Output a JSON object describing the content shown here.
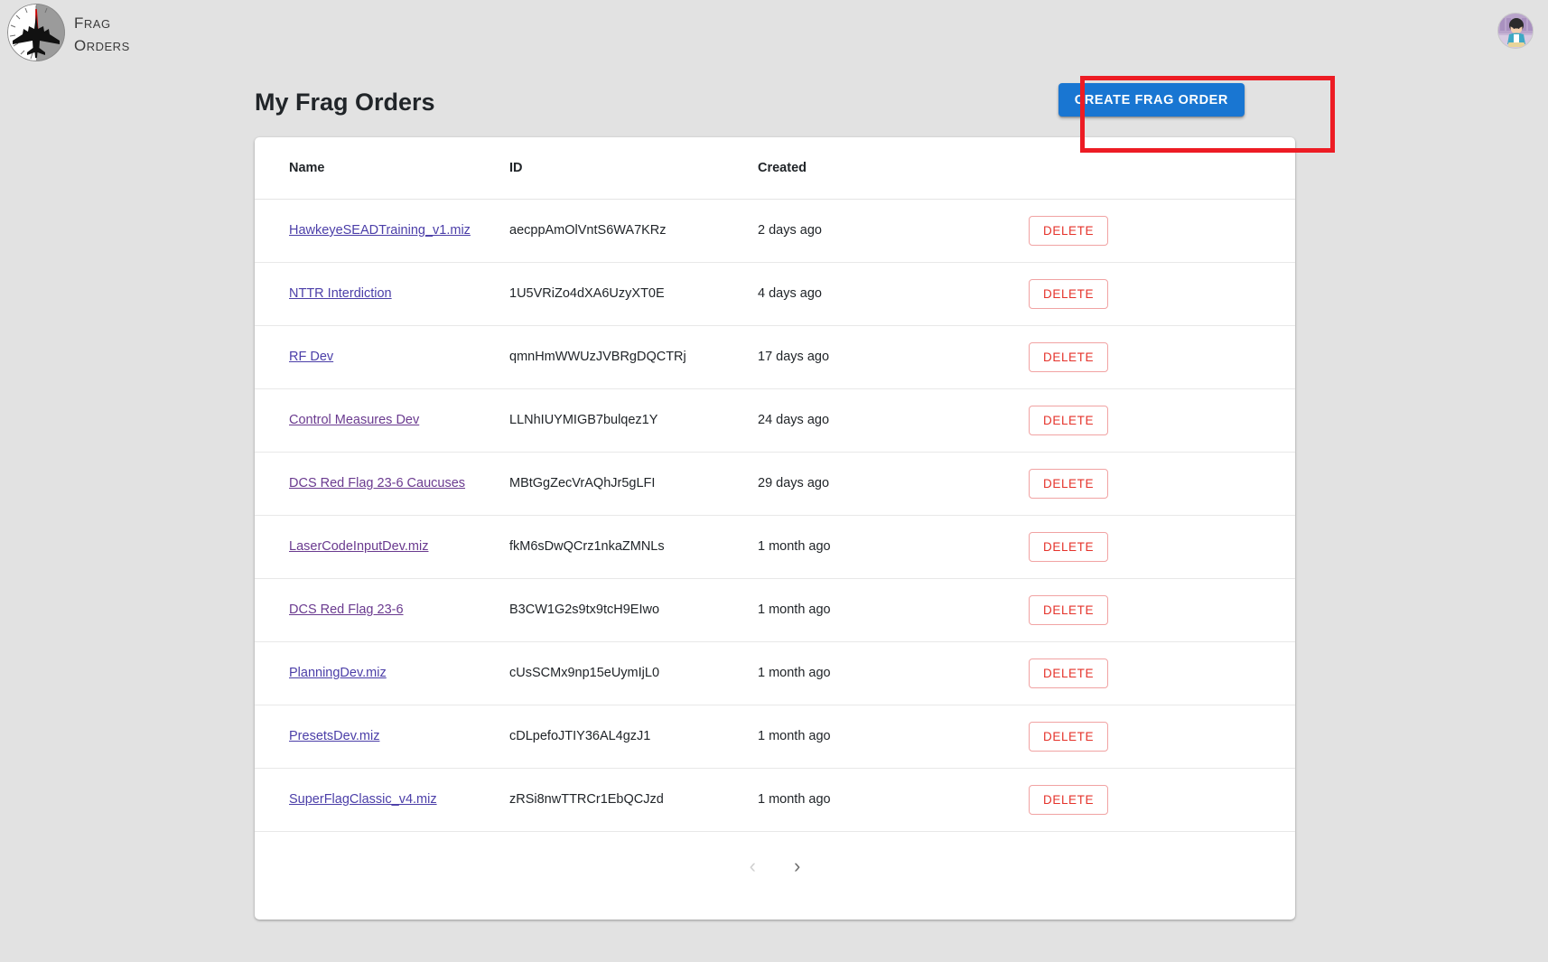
{
  "brand": {
    "logo_icon": "fighter-jet-dial-logo",
    "line1": "Frag",
    "line2": "Orders"
  },
  "account": {
    "avatar_icon": "user-avatar"
  },
  "header": {
    "title": "My Frag Orders",
    "create_button_label": "CREATE FRAG ORDER"
  },
  "annotation": {
    "color": "#ed1c24",
    "target": "create-frag-order-button"
  },
  "table": {
    "columns": [
      "Name",
      "ID",
      "Created",
      ""
    ],
    "rows": [
      {
        "name": "HawkeyeSEADTraining_v1.miz",
        "id": "aecppAmOlVntS6WA7KRz",
        "created": "2 days ago",
        "action": "DELETE"
      },
      {
        "name": "NTTR Interdiction",
        "id": "1U5VRiZo4dXA6UzyXT0E",
        "created": "4 days ago",
        "action": "DELETE"
      },
      {
        "name": "RF Dev",
        "id": "qmnHmWWUzJVBRgDQCTRj",
        "created": "17 days ago",
        "action": "DELETE"
      },
      {
        "name": "Control Measures Dev",
        "id": "LLNhIUYMIGB7bulqez1Y",
        "created": "24 days ago",
        "action": "DELETE"
      },
      {
        "name": "DCS Red Flag 23-6 Caucuses",
        "id": "MBtGgZecVrAQhJr5gLFI",
        "created": "29 days ago",
        "action": "DELETE"
      },
      {
        "name": "LaserCodeInputDev.miz",
        "id": "fkM6sDwQCrz1nkaZMNLs",
        "created": "1 month ago",
        "action": "DELETE"
      },
      {
        "name": "DCS Red Flag 23-6",
        "id": "B3CW1G2s9tx9tcH9EIwo",
        "created": "1 month ago",
        "action": "DELETE"
      },
      {
        "name": "PlanningDev.miz",
        "id": "cUsSCMx9np15eUymIjL0",
        "created": "1 month ago",
        "action": "DELETE"
      },
      {
        "name": "PresetsDev.miz",
        "id": "cDLpefoJTIY36AL4gzJ1",
        "created": "1 month ago",
        "action": "DELETE"
      },
      {
        "name": "SuperFlagClassic_v4.miz",
        "id": "zRSi8nwTTRCr1EbQCJzd",
        "created": "1 month ago",
        "action": "DELETE"
      }
    ]
  },
  "pagination": {
    "prev_icon": "chevron-left-icon",
    "next_icon": "chevron-right-icon",
    "prev_label": "‹",
    "next_label": "›"
  },
  "colors": {
    "page_background": "#e2e2e2",
    "card_background": "#ffffff",
    "primary": "#1976d2",
    "danger": "#e5332b",
    "link": "#4b3ea8",
    "annotation": "#ed1c24"
  }
}
